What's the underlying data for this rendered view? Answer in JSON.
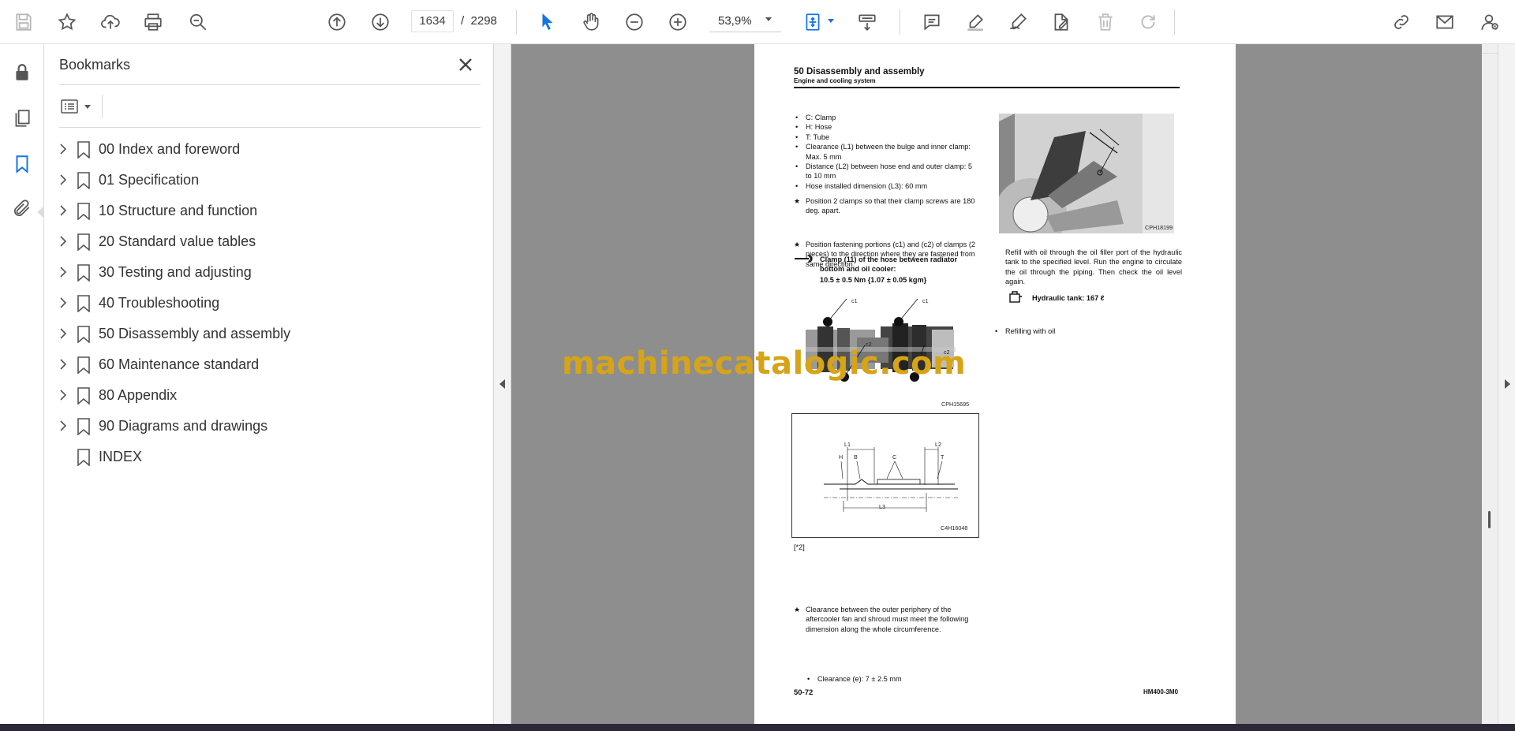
{
  "toolbar": {
    "page_current": "1634",
    "page_separator": "/",
    "page_total": "2298",
    "zoom": "53,9%"
  },
  "bookmarks": {
    "title": "Bookmarks",
    "items": [
      {
        "label": "00 Index and foreword",
        "expandable": true
      },
      {
        "label": "01 Specification",
        "expandable": true
      },
      {
        "label": "10 Structure and function",
        "expandable": true
      },
      {
        "label": "20 Standard value tables",
        "expandable": true
      },
      {
        "label": "30 Testing and adjusting",
        "expandable": true
      },
      {
        "label": "40 Troubleshooting",
        "expandable": true
      },
      {
        "label": "50 Disassembly and assembly",
        "expandable": true
      },
      {
        "label": "60 Maintenance standard",
        "expandable": true
      },
      {
        "label": "80 Appendix",
        "expandable": true
      },
      {
        "label": "90 Diagrams and drawings",
        "expandable": true
      },
      {
        "label": "INDEX",
        "expandable": false
      }
    ]
  },
  "document": {
    "header_title": "50 Disassembly and assembly",
    "header_sub": "Engine and cooling system",
    "left_bullets": [
      "C: Clamp",
      "H: Hose",
      "T: Tube",
      "Clearance (L1) between the bulge and inner clamp: Max. 5 mm",
      "Distance (L2) between hose end and outer clamp: 5 to 10 mm",
      "Hose installed dimension (L3): 60 mm"
    ],
    "star_note_1": "Position 2 clamps so that their clamp screws are 180 deg. apart.",
    "star_note_2": "Position fastening portions (c1) and (c2) of clamps (2 pieces) to the direction where they are fastened from same direction.",
    "torque_label": "Clamp (11) of the hose between radiator bottom and oil cooler:",
    "torque_value": "10.5 ± 0.5 Nm {1.07 ± 0.05 kgm}",
    "fig1_code": "CPH15695",
    "fig1_c1a": "c1",
    "fig1_c1b": "c1",
    "fig1_c2a": "c2",
    "fig1_c2b": "c2",
    "fig2_code": "C4H16048",
    "fig2_labels": {
      "L1": "L1",
      "L2": "L2",
      "L3": "L3",
      "H": "H",
      "B": "B",
      "C": "C",
      "T": "T"
    },
    "ref_2": "[*2]",
    "star_note_3": "Clearance between the outer periphery of the aftercooler fan and shroud must meet the following dimension along the whole circumference.",
    "clearance_bullet": "Clearance (e): 7 ± 2.5 mm",
    "fig3_code": "CPH18199",
    "refill_bullet": "Refilling with oil",
    "refill_text": "Refill with oil through the oil filler port of the hydraulic tank to the specified level. Run the engine to circulate the oil through the piping. Then check the oil level again.",
    "hydraulic_tank": "Hydraulic tank: 167 ℓ",
    "footer_left": "50-72",
    "footer_right": "HM400-3M0"
  },
  "watermark": "machinecatalogic.com",
  "colors": {
    "accent_blue": "#1473e6",
    "watermark": "#d7a417",
    "doc_bg": "#8e8e8e"
  }
}
